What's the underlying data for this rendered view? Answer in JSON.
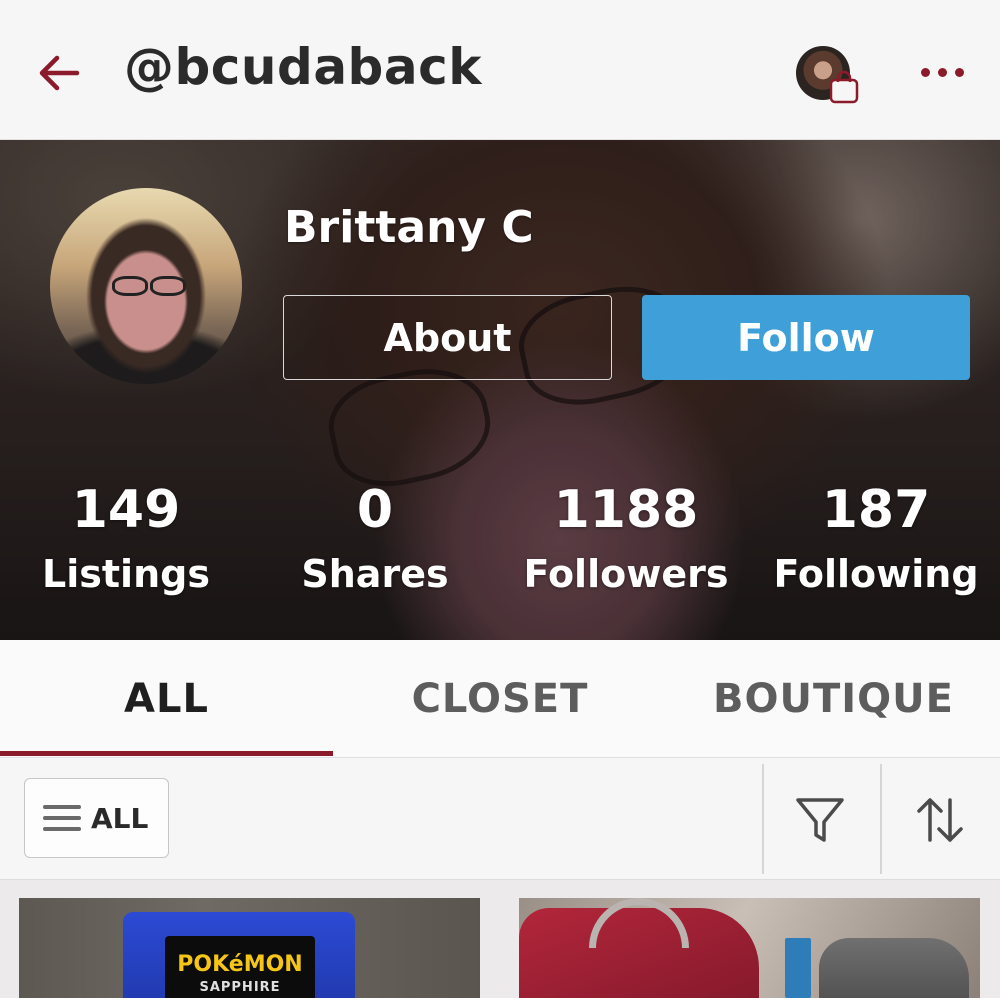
{
  "header": {
    "username": "@bcudaback"
  },
  "profile": {
    "display_name": "Brittany C",
    "about_label": "About",
    "follow_label": "Follow"
  },
  "stats": [
    {
      "value": "149",
      "label": "Listings"
    },
    {
      "value": "0",
      "label": "Shares"
    },
    {
      "value": "1188",
      "label": "Followers"
    },
    {
      "value": "187",
      "label": "Following"
    }
  ],
  "tabs": [
    {
      "label": "ALL",
      "active": true
    },
    {
      "label": "CLOSET",
      "active": false
    },
    {
      "label": "BOUTIQUE",
      "active": false
    }
  ],
  "filters": {
    "category_label": "ALL"
  },
  "listings": [
    {
      "image_text": "POKéMON",
      "image_subtext": "SAPPHIRE"
    },
    {
      "image_text": ""
    }
  ],
  "colors": {
    "accent": "#8b1a2b",
    "follow_button": "#3f9fd8",
    "header_bg": "#f7f6f6"
  },
  "icons": {
    "back": "arrow-left-icon",
    "more": "more-dots-icon",
    "filter": "funnel-icon",
    "sort": "sort-arrows-icon",
    "menu": "hamburger-icon",
    "bag": "shopping-bag-icon"
  }
}
